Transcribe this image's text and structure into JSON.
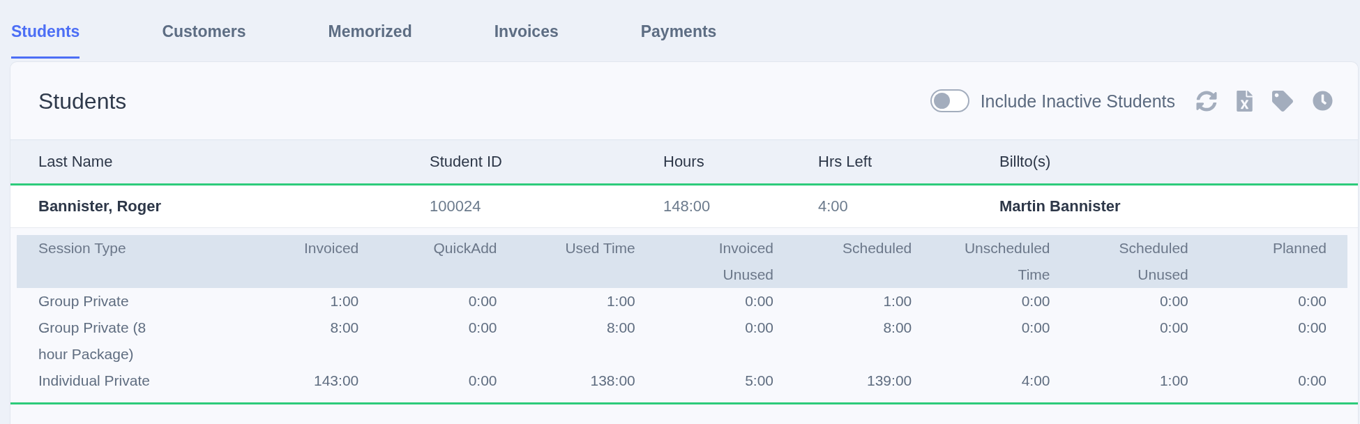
{
  "tabs": [
    {
      "label": "Students",
      "selected": true
    },
    {
      "label": "Customers",
      "selected": false
    },
    {
      "label": "Memorized",
      "selected": false
    },
    {
      "label": "Invoices",
      "selected": false
    },
    {
      "label": "Payments",
      "selected": false
    }
  ],
  "panel": {
    "title": "Students",
    "include_inactive": {
      "label": "Include Inactive Students",
      "on": false
    }
  },
  "table": {
    "columns": [
      "Last Name",
      "Student ID",
      "Hours",
      "Hrs Left",
      "Billto(s)"
    ],
    "rows": [
      {
        "cells": [
          "Bannister, Roger",
          "100024",
          "148:00",
          "4:00",
          "Martin Bannister"
        ],
        "sessions": {
          "columns": [
            "Session Type",
            "Invoiced",
            "QuickAdd",
            "Used Time",
            "Invoiced Unused",
            "Scheduled",
            "Unscheduled Time",
            "Scheduled Unused",
            "Planned"
          ],
          "rows": [
            [
              "Group Private",
              "1:00",
              "0:00",
              "1:00",
              "0:00",
              "1:00",
              "0:00",
              "0:00",
              "0:00"
            ],
            [
              "Group Private (8 hour Package)",
              "8:00",
              "0:00",
              "8:00",
              "0:00",
              "8:00",
              "0:00",
              "0:00",
              "0:00"
            ],
            [
              "Individual Private",
              "143:00",
              "0:00",
              "138:00",
              "5:00",
              "139:00",
              "4:00",
              "1:00",
              "0:00"
            ]
          ]
        }
      }
    ]
  }
}
